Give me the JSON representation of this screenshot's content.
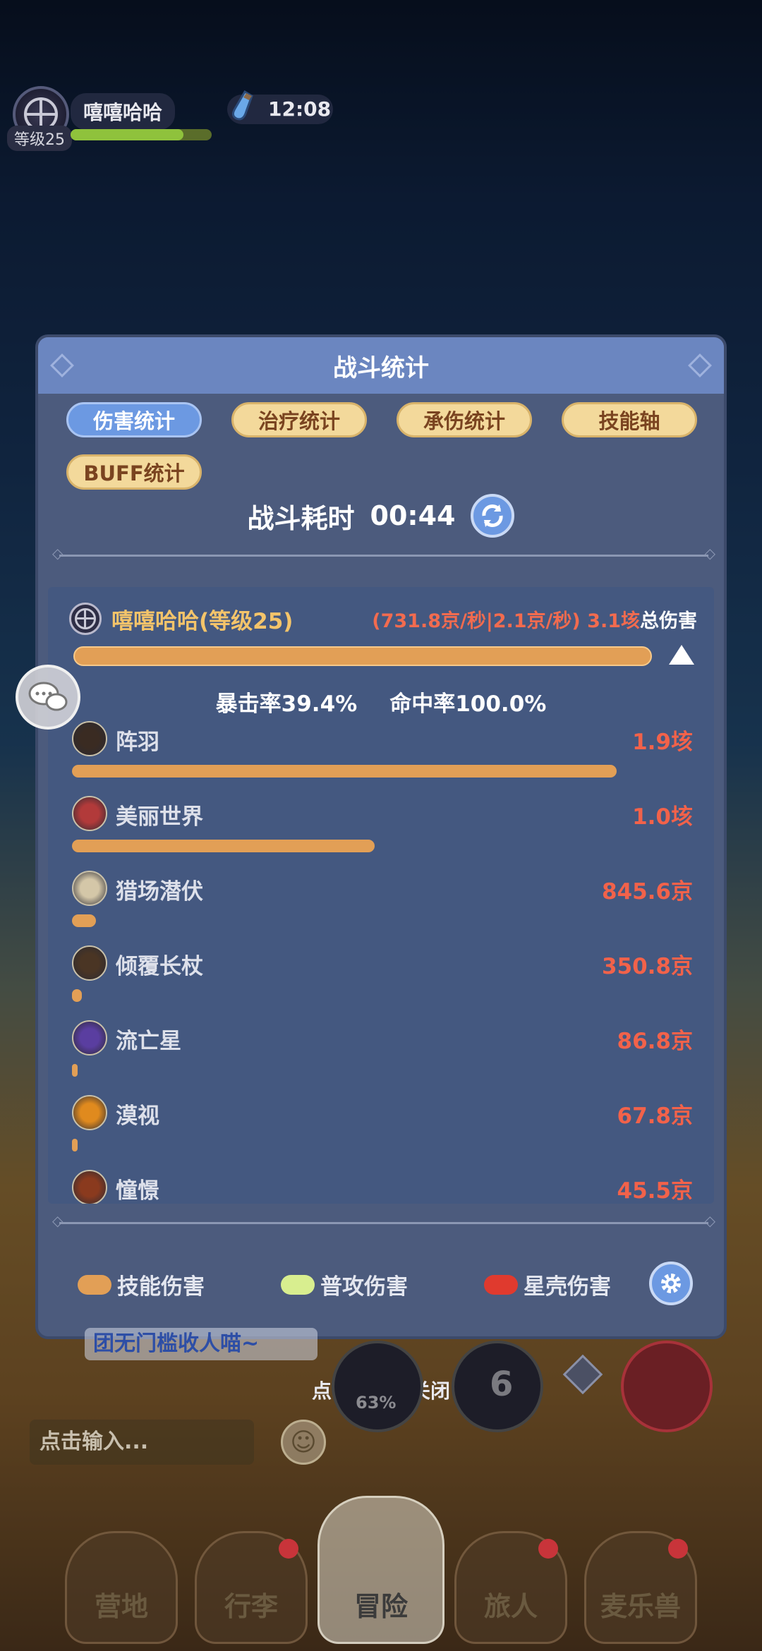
{
  "hud": {
    "player_name": "嘻嘻哈哈",
    "level_label": "等级25",
    "time": "12:08"
  },
  "panel": {
    "title": "战斗统计",
    "tabs": [
      {
        "label": "伤害统计",
        "active": true
      },
      {
        "label": "治疗统计",
        "active": false
      },
      {
        "label": "承伤统计",
        "active": false
      },
      {
        "label": "技能轴",
        "active": false
      },
      {
        "label": "BUFF统计",
        "active": false
      }
    ],
    "duration_label": "战斗耗时",
    "duration_value": "00:44",
    "player": {
      "name": "嘻嘻哈哈(等级25)",
      "rates": "(731.8京/秒|2.1京/秒) 3.1垓",
      "total_label": "总伤害",
      "crit_rate": "暴击率39.4%",
      "hit_rate": "命中率100.0%"
    },
    "skills": [
      {
        "name": "阵羽",
        "value": "1.9垓",
        "fraction": 0.385,
        "icon": "feather-mask-icon",
        "color": "#3a2b22"
      },
      {
        "name": "美丽世界",
        "value": "1.0垓",
        "fraction": 0.214,
        "icon": "red-hair-girl-icon",
        "color": "#b23a3a"
      },
      {
        "name": "猎场潜伏",
        "value": "845.6京",
        "fraction": 0.017,
        "icon": "wolf-icon",
        "color": "#d4c7a8"
      },
      {
        "name": "倾覆长杖",
        "value": "350.8京",
        "fraction": 0.007,
        "icon": "fist-icon",
        "color": "#4a3524"
      },
      {
        "name": "流亡星",
        "value": "86.8京",
        "fraction": 0.002,
        "icon": "purple-flower-icon",
        "color": "#5a3ea0"
      },
      {
        "name": "漠视",
        "value": "67.8京",
        "fraction": 0.0015,
        "icon": "orange-rings-icon",
        "color": "#e08a1e"
      },
      {
        "name": "憧憬",
        "value": "45.5京",
        "fraction": 0.001,
        "icon": "helmet-icon",
        "color": "#8a3a1e"
      }
    ],
    "legend": [
      {
        "label": "技能伤害",
        "color": "#e29f56"
      },
      {
        "label": "普攻伤害",
        "color": "#d8ee8f"
      },
      {
        "label": "星壳伤害",
        "color": "#e03a2e"
      }
    ]
  },
  "notice_text": "团无门槛收人喵~",
  "close_hint": "点击空白处关闭",
  "skill_cd": {
    "percent": "63%",
    "number": "6"
  },
  "input": {
    "placeholder": "点击输入..."
  },
  "nav": [
    {
      "label": "营地",
      "badge": false,
      "active": false
    },
    {
      "label": "行李",
      "badge": true,
      "active": false
    },
    {
      "label": "冒险",
      "badge": false,
      "active": true
    },
    {
      "label": "旅人",
      "badge": true,
      "active": false
    },
    {
      "label": "麦乐兽",
      "badge": true,
      "active": false
    }
  ]
}
